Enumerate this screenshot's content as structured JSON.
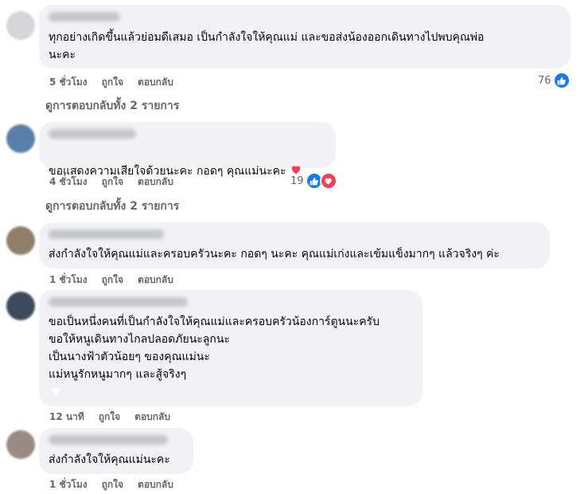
{
  "comments": [
    {
      "text": "ทุกอย่างเกิดขึ้นแล้วย่อมดีเสมอ เป็นกำลังใจให้คุณแม่ และขอส่งน้องออกเดินทางไปพบคุณพ่อ\nนะคะ",
      "time": "5 ชั่วโมง",
      "like": "ถูกใจ",
      "reply": "ตอบกลับ",
      "reaction_count": "76",
      "view_replies": "ดูการตอบกลับทั้ง 2 รายการ"
    },
    {
      "text": "ขอแสดงความเสียใจด้วยนะคะ กอดๆ คุณแม่นะคะ",
      "time": "4 ชั่วโมง",
      "like": "ถูกใจ",
      "reply": "ตอบกลับ",
      "reaction_count": "19",
      "view_replies": "ดูการตอบกลับทั้ง 2 รายการ"
    },
    {
      "text": "ส่งกำลังใจให้คุณแม่และครอบครัวนะคะ กอดๆ นะคะ คุณแม่เก่งและเข้มแข็งมากๆ แล้วจริงๆ ค่ะ",
      "time": "1 ชั่วโมง",
      "like": "ถูกใจ",
      "reply": "ตอบกลับ"
    },
    {
      "text": "ขอเป็นหนึ่งคนที่เป็นกำลังใจให้คุณแม่และครอบครัวน้องการ์ตูนนะครับ\nขอให้หนูเดินทางไกลปลอดภัยนะลูกนะ\nเป็นนางฟ้าตัวน้อยๆ ของคุณแม่นะ\nแม่หนูรักหนูมากๆ และสู้จริงๆ",
      "time": "12 นาที",
      "like": "ถูกใจ",
      "reply": "ตอบกลับ"
    },
    {
      "text": "ส่งกำลังใจให้คุณแม่นะคะ",
      "time": "1 ชั่วโมง",
      "like": "ถูกใจ",
      "reply": "ตอบกลับ"
    }
  ],
  "colors": {
    "like": "#1877f2",
    "love": "#f33e58",
    "bubble": "#f0f2f5",
    "muted": "#65676b"
  }
}
